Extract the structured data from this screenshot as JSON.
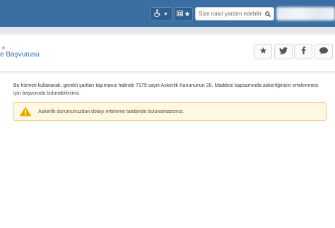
{
  "header": {
    "search_placeholder": "Size nasıl yardım edebilirim?"
  },
  "page": {
    "title": "e Başvurusu"
  },
  "content": {
    "description": "Bu hizmeti kullanarak, gerekli şartları taşımanız halinde 7179 sayılı Askerlik Kanununun 20. Maddesi kapsamında askerliğinizin ertelenmesi için başvuruda bulunabilirsiniz.",
    "alert_message": "Askerlik durumunuzdan dolayı erteleme talebinde bulunamazsınız."
  },
  "colors": {
    "topbar": "#3b6ea2",
    "title": "#3d6f9e",
    "alert_bg": "#fdf8e4",
    "alert_border": "#efc97a",
    "warning_icon": "#f0a400"
  },
  "icons": [
    "accessibility-icon",
    "caret-down-icon",
    "grid-icon",
    "star-icon",
    "search-icon",
    "star-icon",
    "twitter-icon",
    "facebook-icon",
    "comment-icon",
    "warning-icon"
  ]
}
